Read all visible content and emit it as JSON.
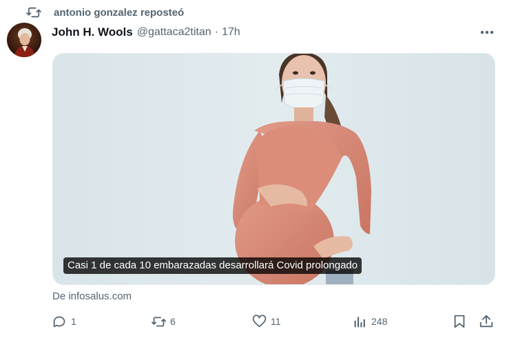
{
  "repost": {
    "label": "antonio gonzalez reposteó"
  },
  "author": {
    "name": "John H. Wools",
    "handle": "@gattaca2titan",
    "separator": "·",
    "time": "17h"
  },
  "media": {
    "caption": "Casi 1 de cada 10 embarazadas desarrollará Covid prolongado"
  },
  "source": "De infosalus.com",
  "actions": {
    "replies": "1",
    "reposts": "6",
    "likes": "11",
    "views": "248"
  },
  "icons": {
    "repost": "repost-icon",
    "more": "more-icon",
    "reply": "reply-icon",
    "like": "heart-icon",
    "views": "views-icon",
    "bookmark": "bookmark-icon",
    "share": "share-icon"
  },
  "colors": {
    "text_primary": "#0f1419",
    "text_secondary": "#536471",
    "media_background": "#dfe9ec"
  }
}
